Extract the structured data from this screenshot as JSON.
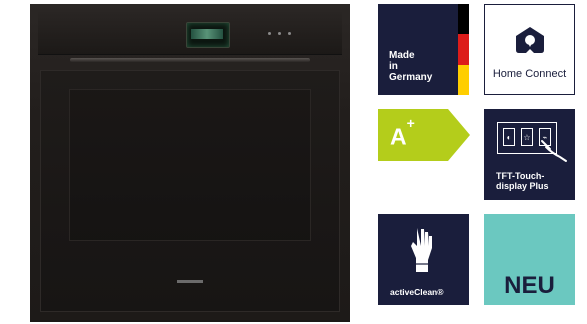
{
  "badges": {
    "made_in": {
      "line1": "Made",
      "line2": "in",
      "line3": "Germany",
      "background": "#1a1e3c",
      "flag_colors": [
        "#000000",
        "#dd1c1a",
        "#ffce00"
      ]
    },
    "home_connect": {
      "label": "Home Connect",
      "icon": "home-connect-icon",
      "color": "#1a1e3c"
    },
    "energy_class": {
      "grade": "A",
      "superscript": "+",
      "color": "#b4cd1b"
    },
    "tft": {
      "line1": "TFT-Touch-",
      "line2": "display Plus",
      "icon": "touch-display-icon"
    },
    "active_clean": {
      "label": "activeClean®",
      "icon": "glove-icon"
    },
    "new": {
      "label": "NEU",
      "background": "#6bc8c0"
    }
  },
  "product": {
    "image": "built-in-oven"
  }
}
